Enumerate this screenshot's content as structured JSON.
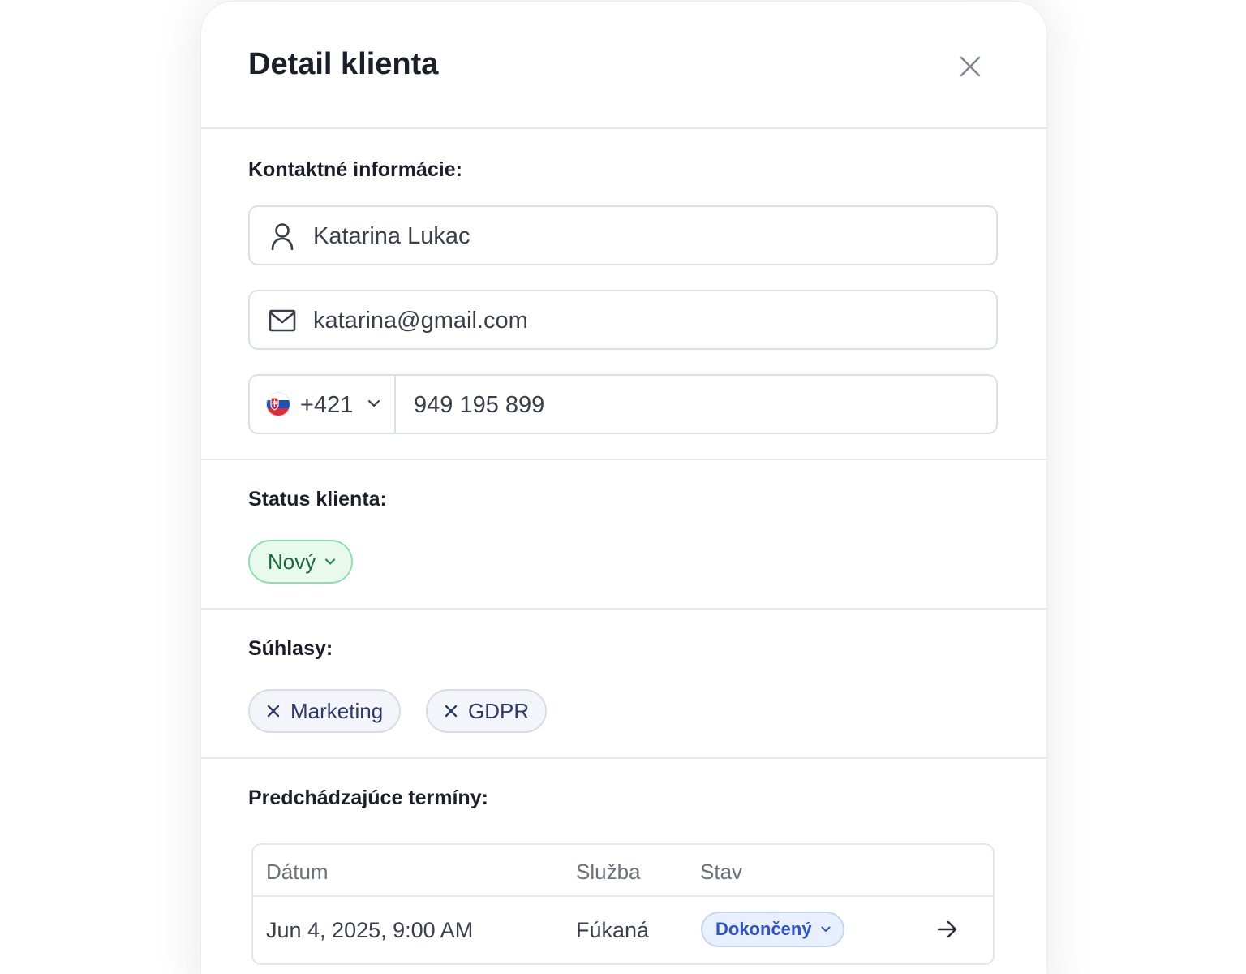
{
  "modal": {
    "title": "Detail klienta",
    "close_icon": "close-icon"
  },
  "contact": {
    "section_title": "Kontaktné informácie:",
    "name": "Katarina Lukac",
    "name_icon": "user-icon",
    "email": "katarina@gmail.com",
    "email_icon": "mail-icon",
    "phone_prefix": "+421",
    "phone_country_flag": "slovakia-flag-icon",
    "phone_number": "949 195 899"
  },
  "status": {
    "section_title": "Status klienta:",
    "value": "Nový",
    "color": "#176b3a",
    "bg": "#e8f9ee"
  },
  "consents": {
    "section_title": "Súhlasy:",
    "items": [
      "Marketing",
      "GDPR"
    ]
  },
  "appointments": {
    "section_title": "Predchádzajúce termíny:",
    "columns": [
      "Dátum",
      "Služba",
      "Stav"
    ],
    "rows": [
      {
        "date": "Jun 4, 2025, 9:00 AM",
        "service": "Fúkaná",
        "state": "Dokončený"
      }
    ]
  },
  "colors": {
    "accent_blue": "#2e53c4",
    "status_green": "#176b3a"
  }
}
